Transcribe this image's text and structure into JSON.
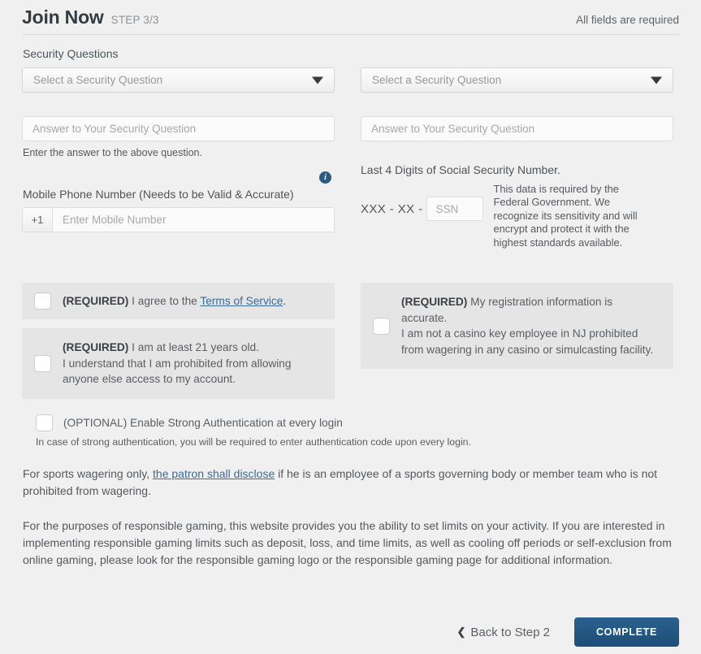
{
  "header": {
    "title": "Join Now",
    "step": "STEP 3/3",
    "all_required": "All fields are required"
  },
  "security": {
    "section_label": "Security Questions",
    "question1_placeholder": "Select a Security Question",
    "question2_placeholder": "Select a Security Question",
    "answer1_placeholder": "Answer to Your Security Question",
    "answer2_placeholder": "Answer to Your Security Question",
    "answer1_helper": "Enter the answer to the above question.",
    "info_icon_glyph": "i"
  },
  "phone": {
    "label": "Mobile Phone Number (Needs to be Valid & Accurate)",
    "country_code": "+1",
    "placeholder": "Enter Mobile Number"
  },
  "ssn": {
    "label": "Last 4 Digits of Social Security Number.",
    "mask": "XXX - XX -",
    "placeholder": "SSN",
    "note": "This data is required by the Federal Government. We recognize its sensitivity and will encrypt and protect it with the highest standards available."
  },
  "agreements": {
    "terms": {
      "required_tag": "(REQUIRED)",
      "text_before": " I agree to the ",
      "link_text": "Terms of Service",
      "text_after": "."
    },
    "age": {
      "required_tag": "(REQUIRED)",
      "line1": " I am at least 21 years old.",
      "line2": "I understand that I am prohibited from allowing anyone else access to my account."
    },
    "accuracy": {
      "required_tag": "(REQUIRED)",
      "line1": " My registration information is accurate.",
      "line2": "I am not a casino key employee in NJ prohibited from wagering in any casino or simulcasting facility."
    },
    "strong_auth": {
      "optional_tag": "(OPTIONAL)",
      "label": " Enable Strong Authentication at every login",
      "note": "In case of strong authentication, you will be required to enter authentication code upon every login."
    }
  },
  "disclosures": {
    "sports_before": "For sports wagering only, ",
    "sports_link": "the patron shall disclose",
    "sports_after": " if he is an employee of a sports governing body or member team who is not prohibited from wagering.",
    "responsible_gaming": "For the purposes of responsible gaming, this website provides you the ability to set limits on your activity. If you are interested in implementing responsible gaming limits such as deposit, loss, and time limits, as well as cooling off periods or self-exclusion from online gaming, please look for the responsible gaming logo or the responsible gaming page for additional information."
  },
  "footer": {
    "back_chevron": "❮",
    "back_label": "Back to Step 2",
    "complete_label": "COMPLETE"
  },
  "colors": {
    "page_background": "#f0f0f0",
    "agreement_block": "#e5e5e5",
    "primary_button": "#1d4d77",
    "link": "#3a6a96",
    "info_icon": "#2a5b87"
  }
}
